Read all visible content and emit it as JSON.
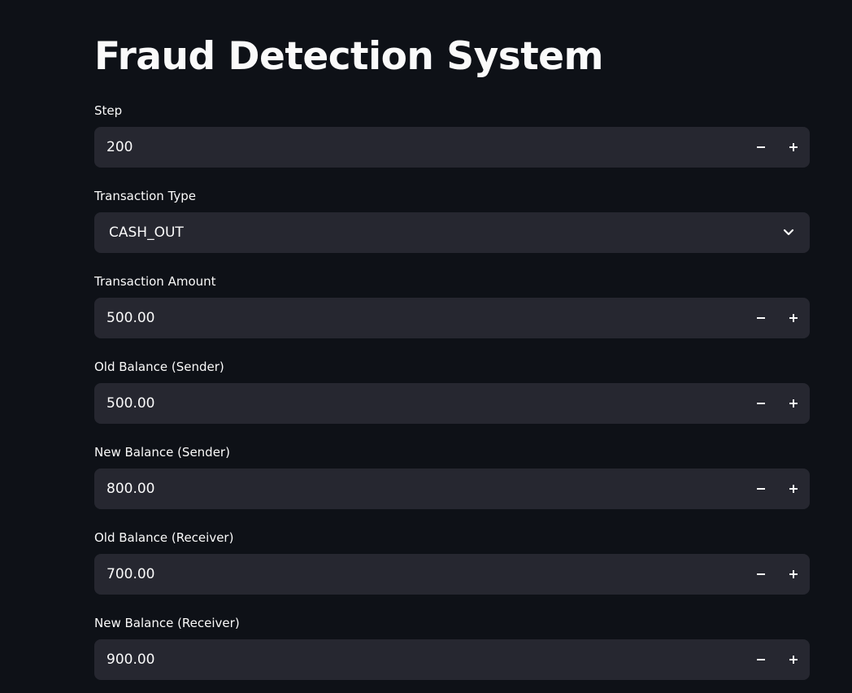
{
  "page": {
    "title": "Fraud Detection System"
  },
  "fields": {
    "step": {
      "label": "Step",
      "value": "200"
    },
    "transaction_type": {
      "label": "Transaction Type",
      "value": "CASH_OUT"
    },
    "amount": {
      "label": "Transaction Amount",
      "value": "500.00"
    },
    "old_balance_sender": {
      "label": "Old Balance (Sender)",
      "value": "500.00"
    },
    "new_balance_sender": {
      "label": "New Balance (Sender)",
      "value": "800.00"
    },
    "old_balance_receiver": {
      "label": "Old Balance (Receiver)",
      "value": "700.00"
    },
    "new_balance_receiver": {
      "label": "New Balance (Receiver)",
      "value": "900.00"
    }
  },
  "icons": {
    "decrement": "minus-icon",
    "increment": "plus-icon",
    "dropdown": "chevron-down-icon"
  },
  "colors": {
    "background": "#0e1117",
    "input_background": "#262730",
    "text": "#fafafa"
  }
}
